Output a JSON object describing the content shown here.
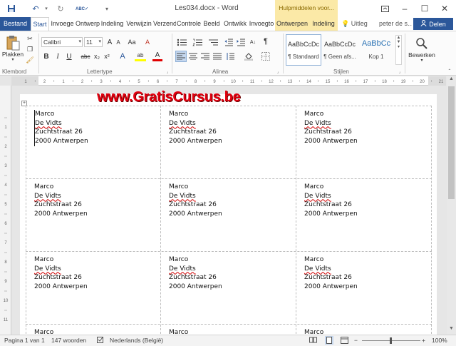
{
  "window": {
    "document_title": "Les034.docx - Word",
    "context_header": "Hulpmiddelen voor...",
    "controls": {
      "ribbon_options_icon": "ribbon-display-options-icon",
      "minimize": "–",
      "maximize": "☐",
      "close": "✕"
    }
  },
  "quick_access": {
    "save_icon": "save-icon",
    "undo_icon": "undo-icon",
    "redo_icon": "redo-icon",
    "spelling_icon": "spelling-check-icon",
    "customize_icon": "customize-toolbar-icon"
  },
  "tabs": [
    "Bestand",
    "Start",
    "Invoege",
    "Ontwerp",
    "Indeling",
    "Verwijzin",
    "Verzend",
    "Controle",
    "Beeld",
    "Ontwikk",
    "Invoegto",
    "Ontwerpen",
    "Indeling"
  ],
  "tell_me": "Uitleg",
  "user": "peter de s...",
  "share": "Delen",
  "ribbon": {
    "clipboard": {
      "paste": "Plakken",
      "group": "Klembord"
    },
    "font": {
      "name": "Calibri",
      "size": "11",
      "group": "Lettertype",
      "grow": "A",
      "shrink": "A",
      "case": "Aa",
      "clear": "A",
      "bold": "B",
      "italic": "I",
      "underline": "U",
      "strike": "abc",
      "sub": "x₂",
      "sup": "x²",
      "effects": "A",
      "highlight": "ab",
      "color": "A"
    },
    "paragraph": {
      "group": "Alinea",
      "pilcrow": "¶"
    },
    "styles": {
      "group": "Stijlen",
      "items": [
        {
          "sample": "AaBbCcDc",
          "name": "¶ Standaard"
        },
        {
          "sample": "AaBbCcDc",
          "name": "¶ Geen afs..."
        },
        {
          "sample": "AaBbCc",
          "name": "Kop 1"
        }
      ]
    },
    "editing": {
      "label": "Bewerken"
    }
  },
  "ruler": {
    "h_numbers": [
      "1",
      "2",
      "1",
      "2",
      "3",
      "4",
      "5",
      "6",
      "7",
      "8",
      "9",
      "10",
      "11",
      "12",
      "13",
      "14",
      "15",
      "16",
      "17",
      "18",
      "19",
      "20",
      "21"
    ],
    "v_numbers": [
      "1",
      "2",
      "3",
      "4",
      "5",
      "6",
      "7",
      "8",
      "9",
      "10",
      "11"
    ]
  },
  "watermark": "www.GratisCursus.be",
  "label": {
    "line1": "Marco",
    "line2": "De Vidts",
    "line3": "Zuchtstraat 26",
    "line4": "2000 Antwerpen"
  },
  "status": {
    "page": "Pagina 1 van 1",
    "words": "147 woorden",
    "language": "Nederlands (België)",
    "zoom": "100%"
  }
}
